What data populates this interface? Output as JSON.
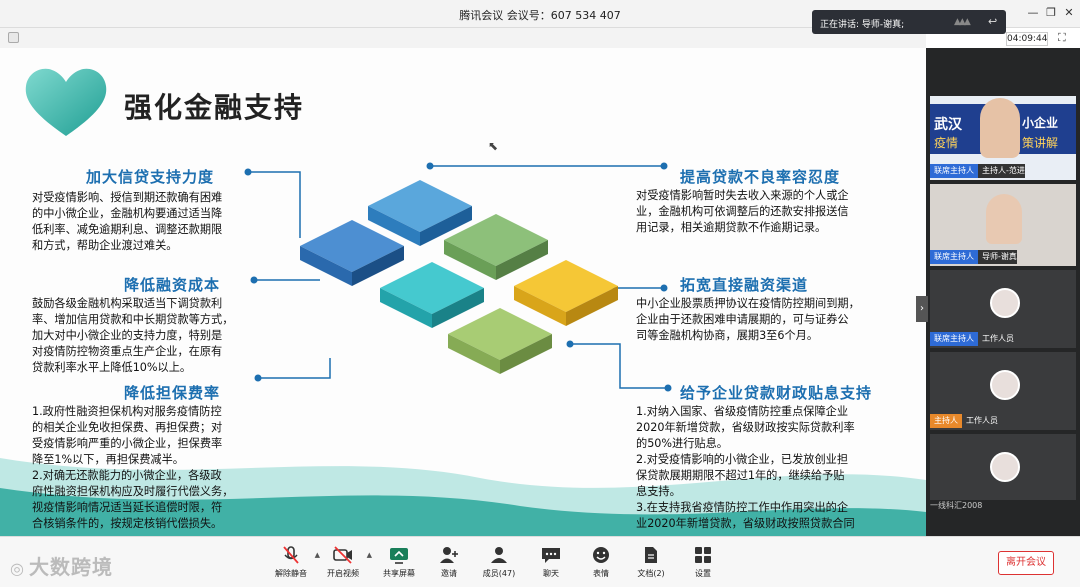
{
  "window": {
    "title": "腾讯会议 会议号：607 534 407",
    "timer": "04:09:44"
  },
  "speaking": {
    "text": "正在讲话: 导师-谢真;"
  },
  "slide": {
    "title": "强化金融支持",
    "sections": [
      {
        "heading": "加大信贷支持力度",
        "lines": [
          "对受疫情影响、授信到期还款确有困难",
          "的中小微企业，金融机构要通过适当降",
          "低利率、减免逾期利息、调整还款期限",
          "和方式，帮助企业渡过难关。"
        ]
      },
      {
        "heading": "降低融资成本",
        "lines": [
          "鼓励各级金融机构采取适当下调贷款利",
          "率、增加信用贷款和中长期贷款等方式，",
          "加大对中小微企业的支持力度，特别是",
          "对疫情防控物资重点生产企业，在原有",
          "贷款利率水平上降低10%以上。"
        ]
      },
      {
        "heading": "降低担保费率",
        "lines": [
          "1.政府性融资担保机构对服务疫情防控",
          "的相关企业免收担保费、再担保费；对",
          "受疫情影响严重的小微企业，担保费率",
          "降至1%以下，再担保费减半。",
          "2.对确无还款能力的小微企业，各级政",
          "府性融资担保机构应及时履行代偿义务，",
          "视疫情影响情况适当延长追偿时限，符",
          "合核销条件的，按规定核销代偿损失。"
        ]
      },
      {
        "heading": "提高贷款不良率容忍度",
        "lines": [
          "对受疫情影响暂时失去收入来源的个人或企",
          "业，金融机构可依调整后的还款安排报送信",
          "用记录，相关逾期贷款不作逾期记录。"
        ]
      },
      {
        "heading": "拓宽直接融资渠道",
        "lines": [
          "中小企业股票质押协议在疫情防控期间到期，",
          "企业由于还款困难申请展期的，可与证券公",
          "司等金融机构协商，展期3至6个月。"
        ]
      },
      {
        "heading": "给予企业贷款财政贴息支持",
        "lines": [
          "1.对纳入国家、省级疫情防控重点保障企业",
          "2020年新增贷款，省级财政按实际贷款利率",
          "的50%进行贴息。",
          "2.对受疫情影响的小微企业，已发放创业担",
          "保贷款展期期限不超过1年的，继续给予贴",
          "息支持。",
          "3.在支持我省疫情防控工作中作用突出的企",
          "业2020年新增贷款，省级财政按照贷款合同"
        ]
      }
    ]
  },
  "participants": [
    {
      "tag": "联席主持人",
      "name": "主持人-范进",
      "tag_color": "#2e6bd6",
      "banner": [
        "武汉",
        "小企业",
        "疫情",
        "策讲解"
      ]
    },
    {
      "tag": "联席主持人",
      "name": "导师-谢真",
      "tag_color": "#2e6bd6"
    },
    {
      "tag": "联席主持人",
      "name": "工作人员",
      "tag_color": "#2e6bd6"
    },
    {
      "tag": "",
      "name": "",
      "tag_color": "#2e6bd6"
    },
    {
      "tag": "主持人",
      "name": "工作人员",
      "tag_color": "#e8892b"
    },
    {
      "tag": "",
      "name": "",
      "tag_color": "#2e6bd6"
    }
  ],
  "sidebar_footer": "一线科汇2008",
  "toolbar": {
    "items": [
      {
        "label": "解除静音",
        "icon": "mic-muted-icon"
      },
      {
        "label": "开启视频",
        "icon": "camera-off-icon"
      },
      {
        "label": "共享屏幕",
        "icon": "share-screen-icon"
      },
      {
        "label": "邀请",
        "icon": "invite-icon"
      },
      {
        "label": "成员(47)",
        "icon": "members-icon"
      },
      {
        "label": "聊天",
        "icon": "chat-icon"
      },
      {
        "label": "表情",
        "icon": "emoji-icon"
      },
      {
        "label": "文档(2)",
        "icon": "document-icon"
      },
      {
        "label": "设置",
        "icon": "settings-icon"
      }
    ],
    "leave_label": "离开会议"
  },
  "watermark": "大数跨境"
}
